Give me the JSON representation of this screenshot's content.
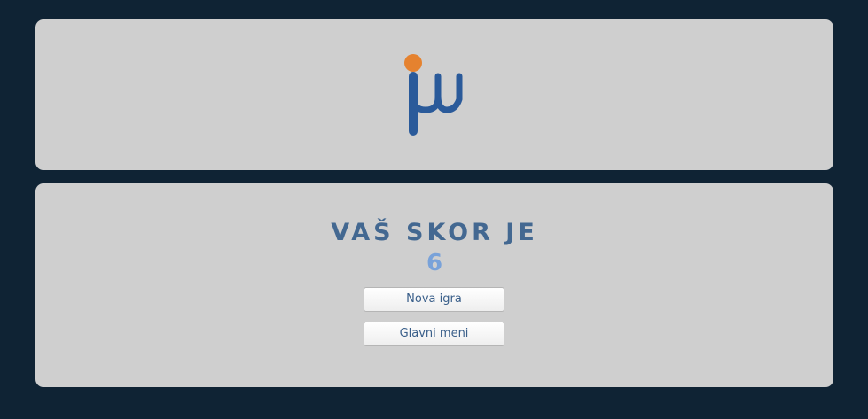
{
  "logo": {
    "icon": "mu-logo-icon",
    "colors": {
      "letter": "#2a5a9a",
      "dot": "#e5822f"
    }
  },
  "score": {
    "title": "VAŠ SKOR JE",
    "value": "6"
  },
  "buttons": {
    "new_game": "Nova igra",
    "main_menu": "Glavni meni"
  }
}
